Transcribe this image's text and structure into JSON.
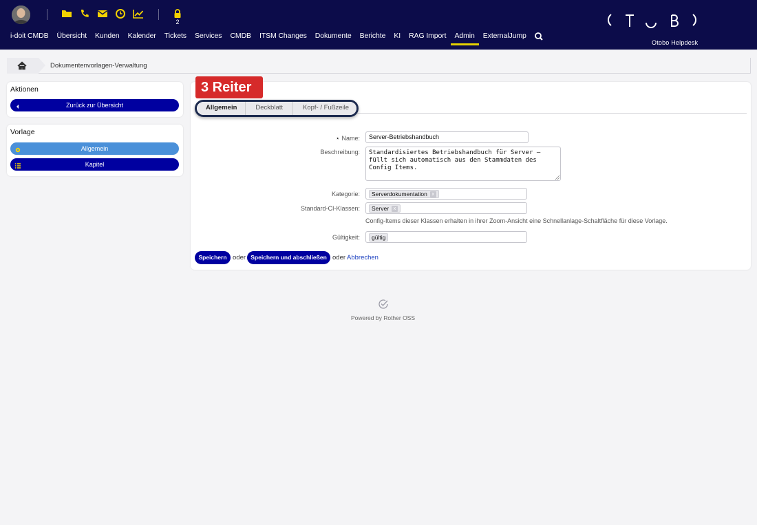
{
  "header": {
    "lock_count": "2",
    "brand_name": "Otobo Helpdesk",
    "toolbar_icons": [
      "folder-icon",
      "phone-icon",
      "mail-icon",
      "clock-icon",
      "chart-icon",
      "lock-icon"
    ],
    "accent_color": "#e6d200",
    "background_color": "#0c0c4a"
  },
  "nav": {
    "items": [
      "i-doit CMDB",
      "Übersicht",
      "Kunden",
      "Kalender",
      "Tickets",
      "Services",
      "CMDB",
      "ITSM Changes",
      "Dokumente",
      "Berichte",
      "KI",
      "RAG Import",
      "Admin",
      "ExternalJump"
    ],
    "active": "Admin"
  },
  "breadcrumb": {
    "label": "Dokumentenvorlagen-Verwaltung"
  },
  "sidebar": {
    "actions_title": "Aktionen",
    "back_button": "Zurück zur Übersicht",
    "template_title": "Vorlage",
    "general_button": "Allgemein",
    "chapter_button": "Kapitel"
  },
  "main": {
    "callout": "3 Reiter",
    "tabs": [
      "Allgemein",
      "Deckblatt",
      "Kopf- / Fußzeile"
    ],
    "active_tab": "Allgemein",
    "form": {
      "name_label": "Name:",
      "name_value": "Server-Betriebshandbuch",
      "description_label": "Beschreibung:",
      "description_value": "Standardisiertes Betriebshandbuch für Server –\nfüllt sich automatisch aus den Stammdaten des\nConfig Items.",
      "category_label": "Kategorie:",
      "category_tag": "Serverdokumentation",
      "ci_classes_label": "Standard-CI-Klassen:",
      "ci_classes_tag": "Server",
      "ci_classes_hint": "Config-Items dieser Klassen erhalten in ihrer Zoom-Ansicht eine Schnellanlage-Schaltfläche für diese Vorlage.",
      "validity_label": "Gültigkeit:",
      "validity_value": "gültig",
      "tag_remove": "x"
    },
    "buttons": {
      "save": "Speichern",
      "or_1": "oder",
      "save_close": "Speichern und abschließen",
      "or_2": "oder",
      "cancel": "Abbrechen"
    }
  },
  "footer": {
    "text": "Powered by Rother OSS"
  }
}
